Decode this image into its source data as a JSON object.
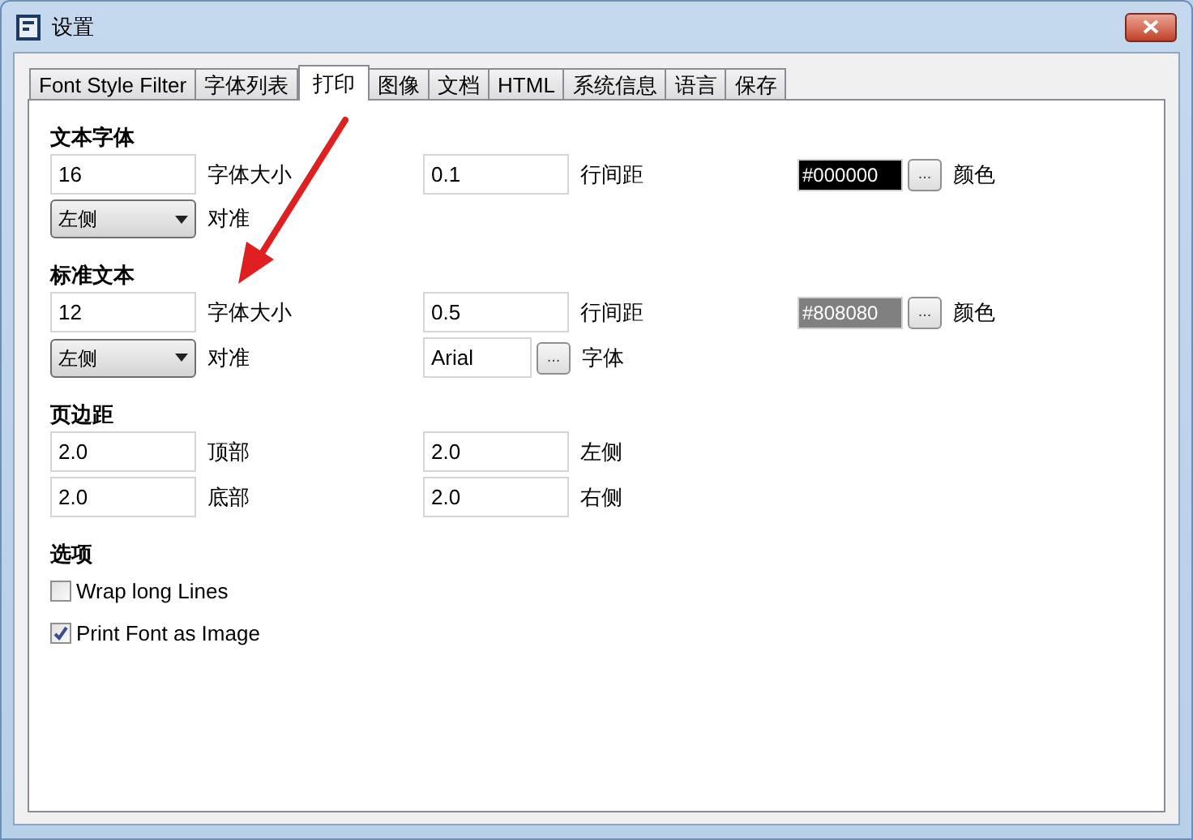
{
  "window": {
    "title": "设置"
  },
  "tabs": [
    {
      "label": "Font Style Filter",
      "selected": false
    },
    {
      "label": "字体列表",
      "selected": false
    },
    {
      "label": "打印",
      "selected": true
    },
    {
      "label": "图像",
      "selected": false
    },
    {
      "label": "文档",
      "selected": false
    },
    {
      "label": "HTML",
      "selected": false
    },
    {
      "label": "系统信息",
      "selected": false
    },
    {
      "label": "语言",
      "selected": false
    },
    {
      "label": "保存",
      "selected": false
    }
  ],
  "sections": [
    {
      "heading": "文本字体",
      "rows": [
        [
          {
            "kind": "text",
            "value": "16",
            "caption": "字体大小"
          },
          {
            "kind": "text",
            "value": "0.1",
            "caption": "行间距"
          },
          {
            "kind": "color",
            "value": "#000000",
            "color": "#000000",
            "button": "...",
            "caption": "颜色"
          }
        ],
        [
          {
            "kind": "dropdown",
            "value": "左侧",
            "caption": "对准"
          }
        ]
      ]
    },
    {
      "heading": "标准文本",
      "rows": [
        [
          {
            "kind": "text",
            "value": "12",
            "caption": "字体大小"
          },
          {
            "kind": "text",
            "value": "0.5",
            "caption": "行间距"
          },
          {
            "kind": "color",
            "value": "#808080",
            "color": "#808080",
            "button": "...",
            "caption": "颜色"
          }
        ],
        [
          {
            "kind": "dropdown",
            "value": "左侧",
            "caption": "对准"
          },
          {
            "kind": "font",
            "value": "Arial",
            "button": "...",
            "caption": "字体"
          }
        ]
      ]
    },
    {
      "heading": "页边距",
      "rows": [
        [
          {
            "kind": "text",
            "value": "2.0",
            "caption": "顶部"
          },
          {
            "kind": "text",
            "value": "2.0",
            "caption": "左侧"
          }
        ],
        [
          {
            "kind": "text",
            "value": "2.0",
            "caption": "底部"
          },
          {
            "kind": "text",
            "value": "2.0",
            "caption": "右侧"
          }
        ]
      ]
    },
    {
      "heading": "选项",
      "rows": [
        [
          {
            "kind": "checkbox",
            "label": "Wrap long Lines",
            "checked": false
          }
        ],
        [
          {
            "kind": "checkbox",
            "label": "Print Font as Image",
            "checked": true
          }
        ]
      ]
    }
  ]
}
